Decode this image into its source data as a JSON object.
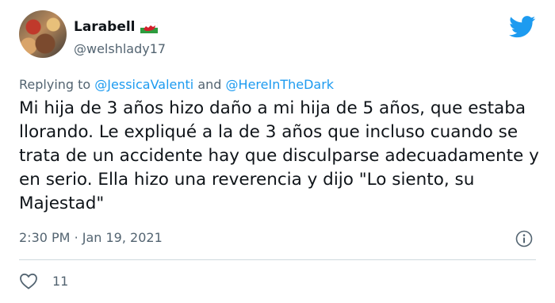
{
  "user": {
    "display_name": "Larabell",
    "flag_icon": "wales-flag-icon",
    "handle": "@welshlady17"
  },
  "reply": {
    "prefix": "Replying to",
    "mention_1": "@JessicaValenti",
    "connector": "and",
    "mention_2": "@HereInTheDark"
  },
  "tweet": {
    "text": "Mi hija de 3 años hizo daño a mi hija de 5 años, que estaba llorando. Le expliqué a la de 3 años que incluso cuando se trata de un accidente hay que disculparse adecuadamente y en serio. Ella hizo una reverencia y dijo \"Lo siento, su Majestad\""
  },
  "meta": {
    "time": "2:30 PM",
    "separator": "·",
    "date": "Jan 19, 2021"
  },
  "engagement": {
    "likes": "11"
  },
  "colors": {
    "accent": "#1d9bf0",
    "text": "#0f1419",
    "secondary": "#536471"
  }
}
